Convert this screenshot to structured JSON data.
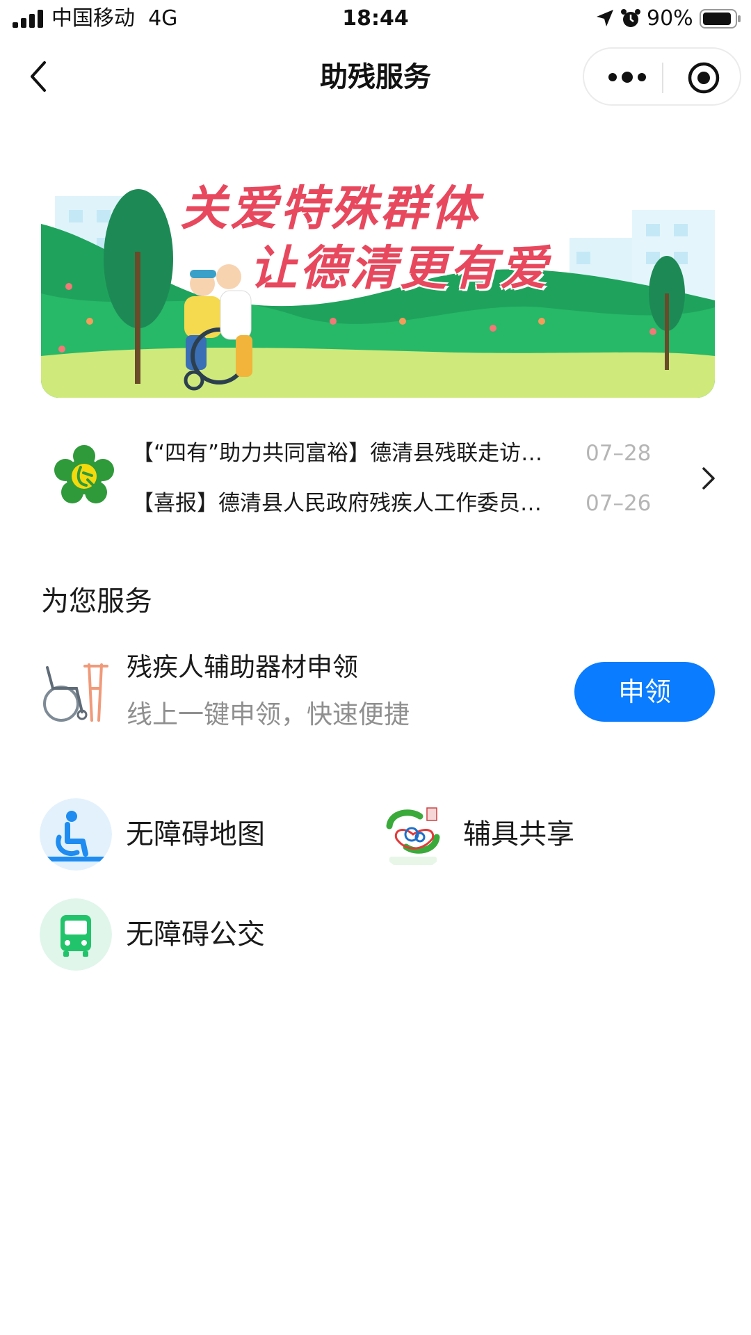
{
  "status_bar": {
    "carrier": "中国移动",
    "network": "4G",
    "time": "18:44",
    "battery": "90%",
    "battery_level": 0.9,
    "icons": [
      "signal-icon",
      "location-icon",
      "alarm-icon",
      "battery-icon"
    ]
  },
  "nav": {
    "title": "助残服务",
    "icons": [
      "back-icon",
      "more-icon",
      "target-icon"
    ]
  },
  "banner": {
    "line1": "关爱特殊群体",
    "line2": "让德清更有爱"
  },
  "news": {
    "items": [
      {
        "title": "【“四有”助力共同富裕】德清县残联走访慰问困难残疾人家庭",
        "date": "07–28"
      },
      {
        "title": "【喜报】德清县人民政府残疾人工作委员会获评先进集体",
        "date": "07–26"
      }
    ]
  },
  "section": {
    "title": "为您服务"
  },
  "apply": {
    "title": "残疾人辅助器材申领",
    "subtitle": "线上一键申领，快速便捷",
    "button": "申领"
  },
  "services": [
    {
      "label": "无障碍地图",
      "icon": "accessibility-icon",
      "color": "#1e8cf0"
    },
    {
      "label": "辅具共享",
      "icon": "assistive-device-share-icon",
      "color": "#3aaa3a"
    },
    {
      "label": "无障碍公交",
      "icon": "bus-icon",
      "color": "#21c46a"
    }
  ],
  "colors": {
    "primary_button": "#0a7cff",
    "banner_text": "#e8485d"
  }
}
